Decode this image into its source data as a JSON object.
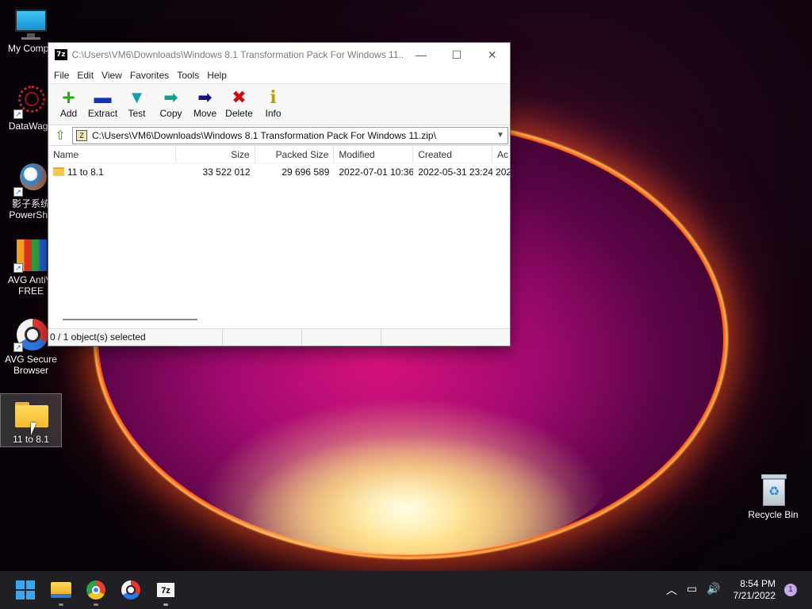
{
  "desktop": {
    "icons": [
      {
        "label": "My Compu",
        "icon": "monitor-icon"
      },
      {
        "label": "DataWago",
        "icon": "datawagon-icon"
      },
      {
        "label": "影子系统",
        "label2": "PowerSha",
        "icon": "powershadow-icon"
      },
      {
        "label": "AVG AntiVi",
        "label2": "FREE",
        "icon": "avg-antivirus-icon"
      },
      {
        "label": "AVG Secure",
        "label2": "Browser",
        "icon": "avg-browser-icon"
      },
      {
        "label": "11 to 8.1",
        "icon": "folder-icon"
      },
      {
        "label": "Recycle Bin",
        "icon": "recycle-bin-icon"
      }
    ]
  },
  "window": {
    "title": "C:\\Users\\VM6\\Downloads\\Windows 8.1 Transformation Pack For Windows 11...",
    "app_icon": "7z",
    "controls": {
      "minimize": "—",
      "maximize": "☐",
      "close": "✕"
    },
    "menu": [
      "File",
      "Edit",
      "View",
      "Favorites",
      "Tools",
      "Help"
    ],
    "toolbar": [
      {
        "label": "Add",
        "glyph": "+",
        "color": "#20b010"
      },
      {
        "label": "Extract",
        "glyph": "▬",
        "color": "#1030c0"
      },
      {
        "label": "Test",
        "glyph": "▼",
        "color": "#10a0b0"
      },
      {
        "label": "Copy",
        "glyph": "➡",
        "color": "#10a090"
      },
      {
        "label": "Move",
        "glyph": "➡",
        "color": "#101090"
      },
      {
        "label": "Delete",
        "glyph": "✖",
        "color": "#d01010"
      },
      {
        "label": "Info",
        "glyph": "i",
        "color": "#c0a000"
      }
    ],
    "address": "C:\\Users\\VM6\\Downloads\\Windows 8.1 Transformation Pack For Windows 11.zip\\",
    "columns": [
      "Name",
      "Size",
      "Packed Size",
      "Modified",
      "Created",
      "Ac"
    ],
    "rows": [
      {
        "name": "11 to 8.1",
        "size": "33 522 012",
        "packed": "29 696 589",
        "modified": "2022-07-01 10:36",
        "created": "2022-05-31 23:24",
        "accessed": "202"
      }
    ],
    "status": "0 / 1 object(s) selected"
  },
  "taskbar": {
    "time": "8:54 PM",
    "date": "7/21/2022",
    "notifications": "1"
  }
}
